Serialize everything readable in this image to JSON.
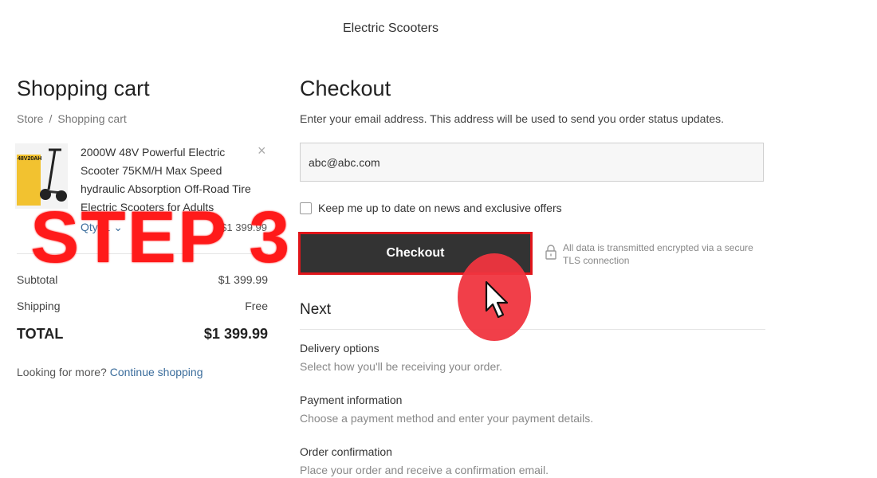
{
  "header": {
    "store_name": "Electric Scooters"
  },
  "cart": {
    "title": "Shopping cart",
    "breadcrumb": {
      "store": "Store",
      "separator": "/",
      "current": "Shopping cart"
    },
    "item": {
      "name": "2000W 48V Powerful Electric Scooter 75KM/H Max Speed hydraulic Absorption Off-Road Tire Electric Scooters for Adults",
      "image_badge": "48V20AH",
      "qty_label": "Qty: 1",
      "price": "$1 399.99"
    },
    "subtotal_label": "Subtotal",
    "subtotal_value": "$1 399.99",
    "shipping_label": "Shipping",
    "shipping_value": "Free",
    "total_label": "TOTAL",
    "total_value": "$1 399.99",
    "more_text": "Looking for more?",
    "continue_link": "Continue shopping"
  },
  "overlay": {
    "step_label": "STEP 3",
    "color": "#ff1a1a"
  },
  "checkout": {
    "title": "Checkout",
    "email_info": "Enter your email address. This address will be used to send you order status updates.",
    "email_value": "abc@abc.com",
    "newsletter_label": "Keep me up to date on news and exclusive offers",
    "button_label": "Checkout",
    "secure_text": "All data is transmitted encrypted via a secure TLS connection",
    "next_title": "Next",
    "steps": [
      {
        "title": "Delivery options",
        "desc": "Select how you'll be receiving your order."
      },
      {
        "title": "Payment information",
        "desc": "Choose a payment method and enter your payment details."
      },
      {
        "title": "Order confirmation",
        "desc": "Place your order and receive a confirmation email."
      }
    ]
  },
  "icons": {
    "remove": "close-icon",
    "qty": "chevron-down-icon",
    "secure": "lock-icon",
    "pointer": "cursor-arrow-icon"
  },
  "colors": {
    "accent_link": "#3b6d9c",
    "button_bg": "#333333",
    "highlight_outline": "#e0151a",
    "click_circle": "#f0353f"
  }
}
